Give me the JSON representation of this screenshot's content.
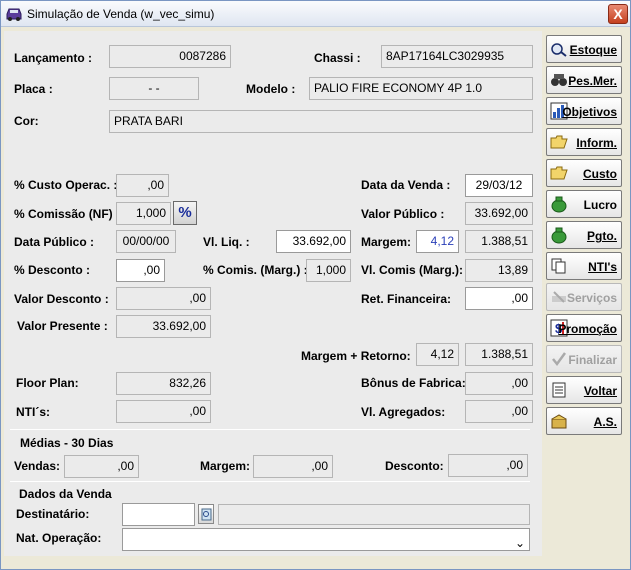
{
  "window": {
    "title": "Simulação de Venda (w_vec_simu)",
    "close_glyph": "X"
  },
  "header": {
    "lancamento_label": "Lançamento :",
    "lancamento_value": "0087286",
    "chassi_label": "Chassi :",
    "chassi_value": "8AP17164LC3029935",
    "placa_label": "Placa :",
    "placa_value": "- -",
    "modelo_label": "Modelo :",
    "modelo_value": "PALIO FIRE ECONOMY 4P 1.0",
    "cor_label": "Cor:",
    "cor_value": "PRATA BARI"
  },
  "costs": {
    "custo_operac_label": "% Custo Operac. :",
    "custo_operac_value": ",00",
    "comissao_nf_label": "% Comissão (NF) :",
    "comissao_nf_value": "1,000",
    "percent_button": "%",
    "data_publico_label": "Data Público :",
    "data_publico_value": "00/00/00",
    "vl_liq_label": "Vl. Liq. :",
    "vl_liq_value": "33.692,00",
    "desconto_pct_label": "% Desconto :",
    "desconto_pct_value": ",00",
    "comis_marg_label": "% Comis. (Marg.) :",
    "comis_marg_value": "1,000",
    "valor_desconto_label": "Valor Desconto :",
    "valor_desconto_value": ",00",
    "valor_presente_label": "Valor Presente :",
    "valor_presente_value": "33.692,00",
    "floor_plan_label": "Floor Plan:",
    "floor_plan_value": "832,26",
    "ntis_label": "NTI´s:",
    "ntis_value": ",00"
  },
  "sale": {
    "data_venda_label": "Data da Venda :",
    "data_venda_value": "29/03/12",
    "valor_publico_label": "Valor Público :",
    "valor_publico_value": "33.692,00",
    "margem_label": "Margem:",
    "margem_pct": "4,12",
    "margem_value": "1.388,51",
    "vl_comis_marg_label": "Vl. Comis (Marg.):",
    "vl_comis_marg_value": "13,89",
    "ret_financeira_label": "Ret. Financeira:",
    "ret_financeira_value": ",00",
    "margem_retorno_label": "Margem + Retorno:",
    "margem_retorno_pct": "4,12",
    "margem_retorno_value": "1.388,51",
    "bonus_fabrica_label": "Bônus de Fabrica:",
    "bonus_fabrica_value": ",00",
    "vl_agregados_label": "Vl. Agregados:",
    "vl_agregados_value": ",00"
  },
  "medias": {
    "title": "Médias - 30 Dias",
    "vendas_label": "Vendas:",
    "vendas_value": ",00",
    "margem_label": "Margem:",
    "margem_value": ",00",
    "desconto_label": "Desconto:",
    "desconto_value": ",00"
  },
  "dados": {
    "title": "Dados da Venda",
    "destinatario_label": "Destinatário:",
    "destinatario_value": "",
    "destinatario_name": "",
    "nat_operacao_label": "Nat. Operação:",
    "nat_operacao_value": ""
  },
  "sidebar": {
    "estoque": "Estoque",
    "pesmer": "Pes.Mer.",
    "objetivos": "Objetivos",
    "inform": "Inform.",
    "custo": "Custo",
    "lucro": "Lucro",
    "pgto": "Pgto.",
    "ntis": "NTI's",
    "servicos": "Serviços",
    "promocao": "Promoção",
    "finalizar": "Finalizar",
    "voltar": "Voltar",
    "as": "A.S."
  },
  "colors": {
    "accent_blue": "#1a2d9a",
    "margem_pct_color": "#2a3fb8"
  }
}
